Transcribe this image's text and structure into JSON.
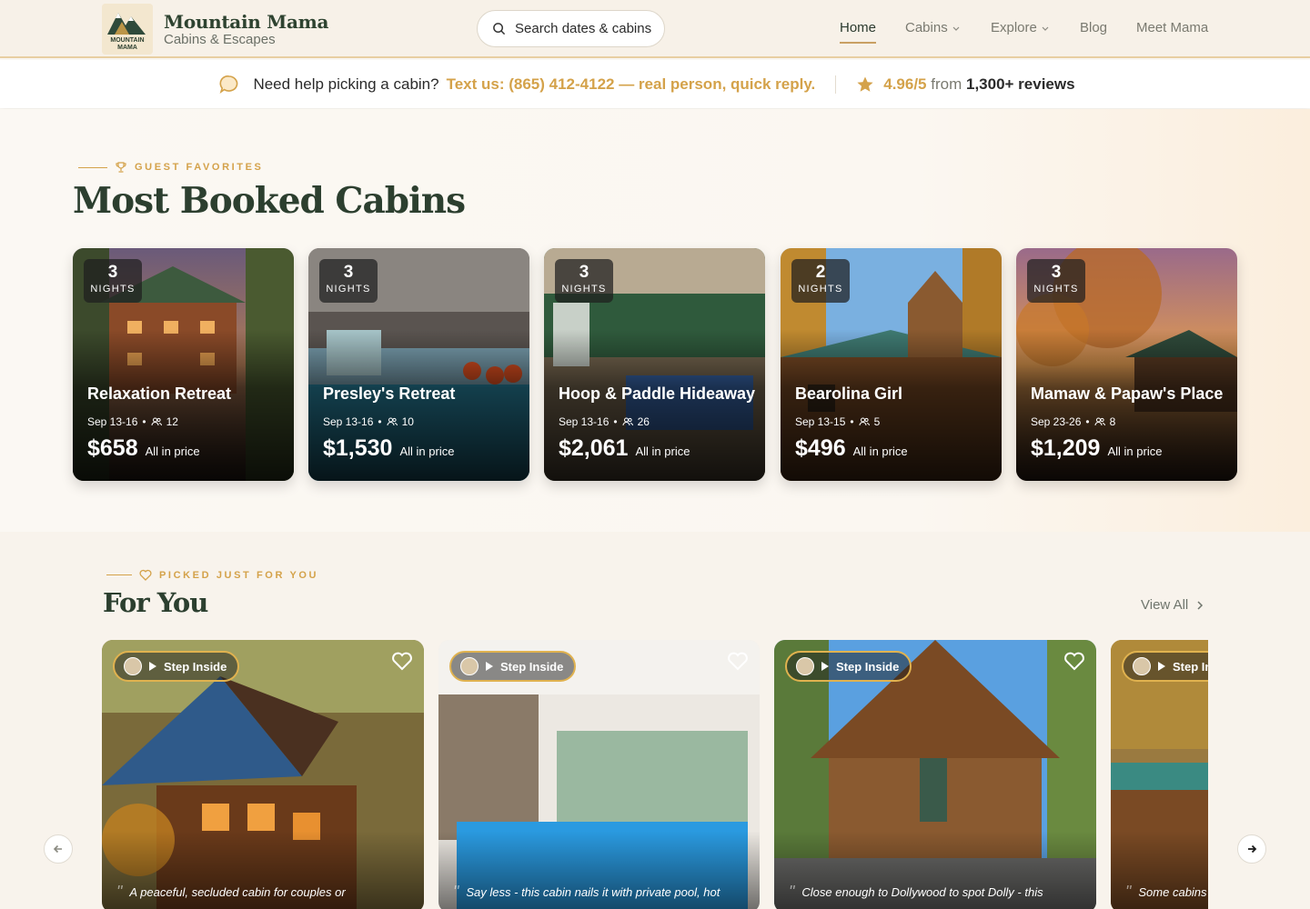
{
  "brand": {
    "title": "Mountain Mama",
    "subtitle": "Cabins & Escapes",
    "logo_text": "MOUNTAIN MAMA"
  },
  "search": {
    "label": "Search dates & cabins"
  },
  "nav": [
    {
      "label": "Home",
      "active": true
    },
    {
      "label": "Cabins",
      "dropdown": true
    },
    {
      "label": "Explore",
      "dropdown": true
    },
    {
      "label": "Blog"
    },
    {
      "label": "Meet Mama"
    }
  ],
  "helpbar": {
    "question": "Need help picking a cabin?",
    "text_us": "Text us: (865)  412-4122 — real person, quick reply.",
    "rating": "4.96/5",
    "from": "from",
    "reviews": "1,300+ reviews"
  },
  "most_booked": {
    "eyebrow": "GUEST FAVORITES",
    "title": "Most Booked Cabins",
    "cabins": [
      {
        "nights": "3",
        "nights_label": "NIGHTS",
        "name": "Relaxation Retreat",
        "dates": "Sep 13-16",
        "guests": "12",
        "price": "$658",
        "price_note": "All in price"
      },
      {
        "nights": "3",
        "nights_label": "NIGHTS",
        "name": "Presley's Retreat",
        "dates": "Sep 13-16",
        "guests": "10",
        "price": "$1,530",
        "price_note": "All in price"
      },
      {
        "nights": "3",
        "nights_label": "NIGHTS",
        "name": "Hoop & Paddle Hideaway",
        "dates": "Sep 13-16",
        "guests": "26",
        "price": "$2,061",
        "price_note": "All in price"
      },
      {
        "nights": "2",
        "nights_label": "NIGHTS",
        "name": "Bearolina Girl",
        "dates": "Sep 13-15",
        "guests": "5",
        "price": "$496",
        "price_note": "All in price"
      },
      {
        "nights": "3",
        "nights_label": "NIGHTS",
        "name": "Mamaw & Papaw's Place",
        "dates": "Sep 23-26",
        "guests": "8",
        "price": "$1,209",
        "price_note": "All in price"
      }
    ]
  },
  "for_you": {
    "eyebrow": "PICKED JUST FOR YOU",
    "title": "For You",
    "view_all": "View All",
    "cards": [
      {
        "step": "Step Inside",
        "quote": "A peaceful, secluded cabin for couples or"
      },
      {
        "step": "Step Inside",
        "quote": "Say less - this cabin nails it with private pool, hot"
      },
      {
        "step": "Step Inside",
        "quote": "Close enough to Dollywood to spot Dolly - this"
      },
      {
        "step": "Step Inside",
        "quote": "Some cabins"
      }
    ]
  },
  "colors": {
    "accent": "#d4a24a",
    "forest": "#2c3f2f",
    "bg": "#fbf8f3"
  },
  "icons": [
    "search-icon",
    "chevron-down-icon",
    "chat-bubble-icon",
    "star-icon",
    "trophy-icon",
    "people-icon",
    "heart-outline-icon",
    "play-icon",
    "arrow-left-icon",
    "arrow-right-icon",
    "chevron-right-icon"
  ]
}
